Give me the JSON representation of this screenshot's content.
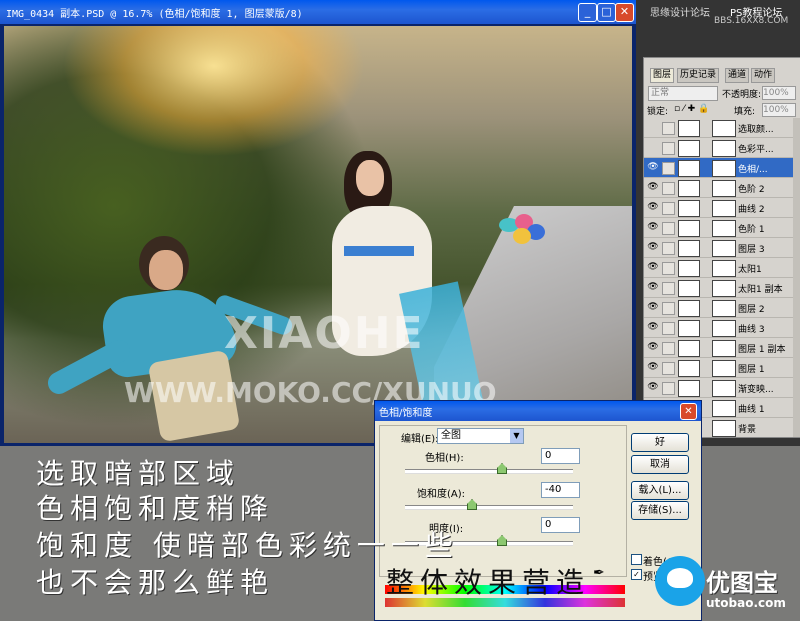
{
  "document": {
    "title": "IMG_0434 副本.PSD @ 16.7% (色相/饱和度 1, 图层蒙版/8)",
    "photo_watermark_1": "XIAOHE",
    "photo_watermark_2": "WWW.MOKO.CC/XUNUO"
  },
  "site_watermark": {
    "left": "思缘设计论坛",
    "right": "PS教程论坛",
    "url": "BBS.16XX8.COM"
  },
  "layers_panel": {
    "tabs": [
      "图层",
      "历史记录",
      "通道",
      "动作"
    ],
    "blend_mode": "正常",
    "opacity_label": "不透明度:",
    "opacity_value": "100%",
    "lock_label": "锁定:",
    "fill_label": "填充:",
    "fill_value": "100%",
    "layers": [
      {
        "name": "选取颜...",
        "visible": false
      },
      {
        "name": "色彩平...",
        "visible": false
      },
      {
        "name": "色相/...",
        "visible": true,
        "selected": true
      },
      {
        "name": "色阶 2",
        "visible": true
      },
      {
        "name": "曲线 2",
        "visible": true
      },
      {
        "name": "色阶 1",
        "visible": true
      },
      {
        "name": "图层 3",
        "visible": true
      },
      {
        "name": "太阳1",
        "visible": true
      },
      {
        "name": "太阳1 副本",
        "visible": true
      },
      {
        "name": "图层 2",
        "visible": true
      },
      {
        "name": "曲线 3",
        "visible": true
      },
      {
        "name": "图层 1 副本",
        "visible": true
      },
      {
        "name": "图层 1",
        "visible": true
      },
      {
        "name": "渐变映...",
        "visible": true
      },
      {
        "name": "曲线 1",
        "visible": true
      },
      {
        "name": "背景",
        "visible": true
      }
    ]
  },
  "dialog": {
    "title": "色相/饱和度",
    "edit_label": "编辑(E):",
    "edit_value": "全图",
    "hue_label": "色相(H):",
    "hue_value": "0",
    "sat_label": "饱和度(A):",
    "sat_value": "-40",
    "light_label": "明度(I):",
    "light_value": "0",
    "ok": "好",
    "cancel": "取消",
    "load": "载入(L)...",
    "save": "存储(S)...",
    "colorize": "着色(O)",
    "preview": "预览(P)"
  },
  "captions": {
    "line1": "选取暗部区域",
    "line2": "色相饱和度稍降",
    "line3": "饱和度 使暗部色彩统一一些",
    "line4a": "也不会那么鲜艳",
    "line4b": "整体效果营造"
  },
  "logo": {
    "name": "优图宝",
    "url": "utobao.com"
  }
}
